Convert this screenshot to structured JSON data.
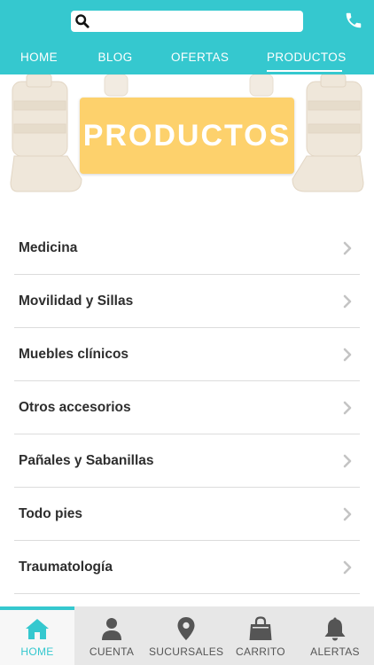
{
  "header": {
    "search": {
      "value": "",
      "placeholder": ""
    },
    "colors": {
      "accent": "#35c8cf"
    }
  },
  "nav": {
    "items": [
      {
        "label": "HOME"
      },
      {
        "label": "BLOG"
      },
      {
        "label": "OFERTAS"
      },
      {
        "label": "PRODUCTOS",
        "active": true
      }
    ]
  },
  "banner": {
    "title": "PRODUCTOS",
    "box_color": "#fdd16c"
  },
  "categories": [
    {
      "label": "Medicina"
    },
    {
      "label": "Movilidad y Sillas"
    },
    {
      "label": "Muebles clínicos"
    },
    {
      "label": "Otros accesorios"
    },
    {
      "label": "Pañales y Sabanillas"
    },
    {
      "label": "Todo pies"
    },
    {
      "label": "Traumatología"
    }
  ],
  "tabbar": {
    "items": [
      {
        "label": "HOME",
        "icon": "home-icon",
        "active": true
      },
      {
        "label": "CUENTA",
        "icon": "user-icon"
      },
      {
        "label": "SUCURSALES",
        "icon": "map-pin-icon"
      },
      {
        "label": "CARRITO",
        "icon": "shopping-bag-icon"
      },
      {
        "label": "ALERTAS",
        "icon": "bell-icon"
      }
    ]
  }
}
